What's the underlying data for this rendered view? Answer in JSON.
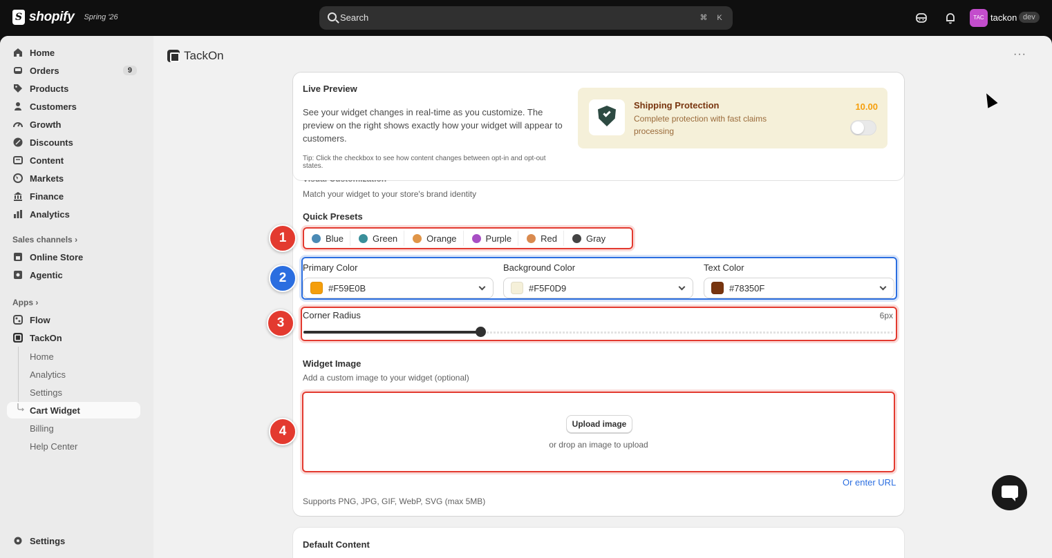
{
  "topbar": {
    "logo_text": "shopify",
    "edition": "Spring '26",
    "search_placeholder": "Search",
    "shortcut_cmd": "⌘",
    "shortcut_key": "K",
    "avatar_initials": "TAC",
    "store_name": "tackon",
    "env_badge": "dev"
  },
  "sidebar": {
    "items": [
      {
        "label": "Home",
        "icon": "home-icon"
      },
      {
        "label": "Orders",
        "icon": "inbox-icon",
        "badge": "9"
      },
      {
        "label": "Products",
        "icon": "tag-icon"
      },
      {
        "label": "Customers",
        "icon": "person-icon"
      },
      {
        "label": "Growth",
        "icon": "gauge-icon"
      },
      {
        "label": "Discounts",
        "icon": "discount-icon"
      },
      {
        "label": "Content",
        "icon": "content-icon"
      },
      {
        "label": "Markets",
        "icon": "globe-icon"
      },
      {
        "label": "Finance",
        "icon": "bank-icon"
      },
      {
        "label": "Analytics",
        "icon": "bar-chart-icon"
      }
    ],
    "sales_channels_label": "Sales channels",
    "sales_channels": [
      {
        "label": "Online Store",
        "icon": "store-icon"
      },
      {
        "label": "Agentic",
        "icon": "agentic-icon"
      }
    ],
    "apps_label": "Apps",
    "apps": [
      {
        "label": "Flow",
        "icon": "flow-icon"
      },
      {
        "label": "TackOn",
        "icon": "tackon-icon"
      }
    ],
    "tackon_sub": [
      "Home",
      "Analytics",
      "Settings",
      "Cart Widget",
      "Billing",
      "Help Center"
    ],
    "settings_label": "Settings"
  },
  "app": {
    "title": "TackOn",
    "more": "···"
  },
  "live_preview": {
    "title": "Live Preview",
    "description": "See your widget changes in real-time as you customize. The preview on the right shows exactly how your widget will appear to customers.",
    "tip": "Tip: Click the checkbox to see how content changes between opt-in and opt-out states.",
    "widget": {
      "title": "Shipping Protection",
      "description": "Complete protection with fast claims processing",
      "price": "10.00",
      "toggle_on": false
    }
  },
  "visual": {
    "title_partial": "Visual Customization",
    "subtitle": "Match your widget to your store's brand identity",
    "presets_label": "Quick Presets",
    "presets": [
      {
        "label": "Blue",
        "color": "#4a8ab5"
      },
      {
        "label": "Green",
        "color": "#3a8f9a"
      },
      {
        "label": "Orange",
        "color": "#e09548"
      },
      {
        "label": "Purple",
        "color": "#a84fc4"
      },
      {
        "label": "Red",
        "color": "#d98a4f"
      },
      {
        "label": "Gray",
        "color": "#444444"
      }
    ],
    "primary_color": {
      "label": "Primary Color",
      "value": "#F59E0B",
      "swatch": "#F59E0B"
    },
    "background_color": {
      "label": "Background Color",
      "value": "#F5F0D9",
      "swatch": "#F5F0D9"
    },
    "text_color": {
      "label": "Text Color",
      "value": "#78350F",
      "swatch": "#78350F"
    },
    "corner_radius": {
      "label": "Corner Radius",
      "value_label": "6px",
      "fraction": 0.3
    }
  },
  "widget_image": {
    "title": "Widget Image",
    "subtitle": "Add a custom image to your widget (optional)",
    "upload_button": "Upload image",
    "drop_hint": "or drop an image to upload",
    "url_link": "Or enter URL",
    "supports": "Supports PNG, JPG, GIF, WebP, SVG (max 5MB)"
  },
  "default_content": {
    "title": "Default Content"
  },
  "markers": [
    "1",
    "2",
    "3",
    "4"
  ]
}
